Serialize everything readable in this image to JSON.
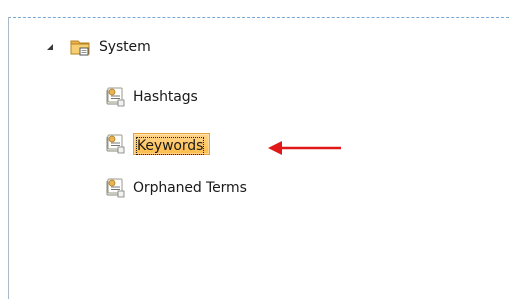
{
  "tree": {
    "root": {
      "label": "System",
      "expanded": true,
      "icon": "folder-icon"
    },
    "children": [
      {
        "label": "Hashtags",
        "icon": "term-set-icon",
        "selected": false
      },
      {
        "label": "Keywords",
        "icon": "term-set-icon",
        "selected": true
      },
      {
        "label": "Orphaned Terms",
        "icon": "term-set-icon",
        "selected": false
      }
    ]
  },
  "annotation": {
    "arrow_color": "#e01818",
    "points_to": "Keywords"
  },
  "colors": {
    "selection_fill": "#ffc75a",
    "selection_border": "#e5a23a",
    "frame_border": "#7aa6d8"
  }
}
